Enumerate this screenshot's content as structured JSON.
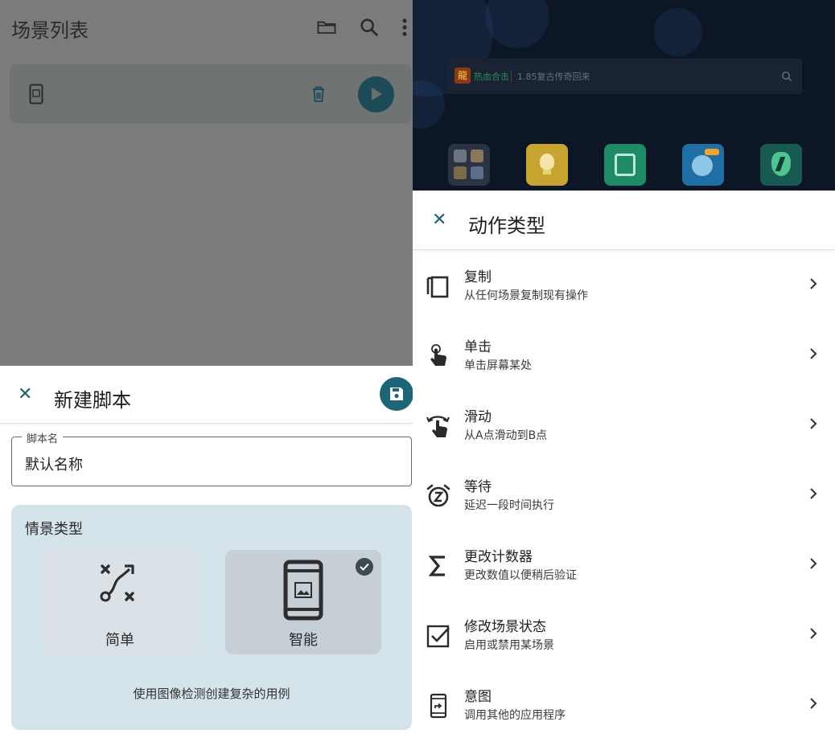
{
  "left": {
    "app_title": "场景列表",
    "icons": [
      "folder-icon",
      "search-icon",
      "more-vert-icon"
    ],
    "scene": {
      "icons": [
        "phone-icon",
        "trash-icon",
        "play-icon"
      ]
    },
    "dialog": {
      "title": "新建脚本",
      "close_label": "✕",
      "field_label": "脚本名",
      "field_value": "默认名称",
      "scenario_title": "情景类型",
      "options": [
        {
          "label": "简单",
          "icon": "route-icon",
          "selected": false
        },
        {
          "label": "智能",
          "icon": "phone-image-icon",
          "selected": true
        }
      ],
      "description": "使用图像检测创建复杂的用例"
    }
  },
  "right": {
    "background": {
      "brand": "热血合击",
      "search_text": "1.85复古传奇回来",
      "apps": [
        "folder-app",
        "bulb-app",
        "recycle-app",
        "fish-app",
        "shield-app"
      ]
    },
    "dialog": {
      "title": "动作类型",
      "close_label": "✕",
      "actions": [
        {
          "title": "复制",
          "subtitle": "从任何场景复制现有操作",
          "icon": "copy-icon"
        },
        {
          "title": "单击",
          "subtitle": "单击屏幕某处",
          "icon": "tap-icon"
        },
        {
          "title": "滑动",
          "subtitle": "从A点滑动到B点",
          "icon": "swipe-icon"
        },
        {
          "title": "等待",
          "subtitle": "延迟一段时间执行",
          "icon": "alarm-icon"
        },
        {
          "title": "更改计数器",
          "subtitle": "更改数值以便稍后验证",
          "icon": "sigma-icon"
        },
        {
          "title": "修改场景状态",
          "subtitle": "启用或禁用某场景",
          "icon": "checkbox-icon"
        },
        {
          "title": "意图",
          "subtitle": "调用其他的应用程序",
          "icon": "intent-phone-icon"
        }
      ]
    }
  },
  "colors": {
    "accent": "#1c6678",
    "dim_overlay": "#7b7b7b",
    "scenario_bg": "#d5e3ea"
  }
}
